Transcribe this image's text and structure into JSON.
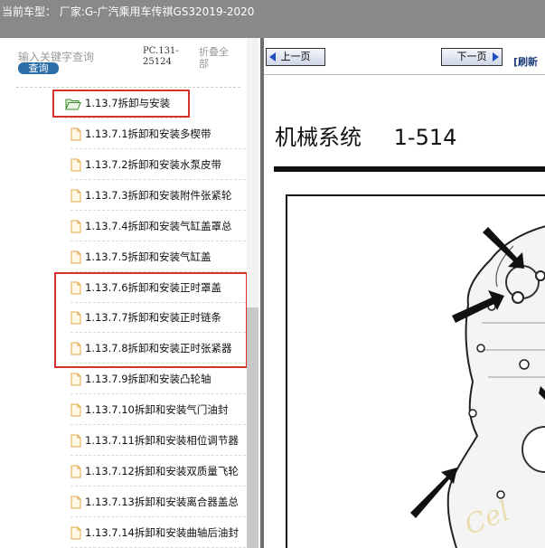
{
  "header": {
    "title": "当前车型：  厂家:G-广汽乘用车传祺GS32019-2020"
  },
  "sidebar": {
    "search_placeholder": "输入关键字查询",
    "query_button": "查询",
    "pc_code": [
      "PC.131-",
      "25124"
    ],
    "fold_all": [
      "折叠全",
      "部"
    ],
    "folder": {
      "label": "1.13.7拆卸与安装",
      "icon": "folder-open-icon"
    },
    "items": [
      {
        "label": "1.13.7.1拆卸和安装多楔带"
      },
      {
        "label": "1.13.7.2拆卸和安装水泵皮带"
      },
      {
        "label": "1.13.7.3拆卸和安装附件张紧轮"
      },
      {
        "label": "1.13.7.4拆卸和安装气缸盖罩总"
      },
      {
        "label": "1.13.7.5拆卸和安装气缸盖"
      },
      {
        "label": "1.13.7.6拆卸和安装正时罩盖"
      },
      {
        "label": "1.13.7.7拆卸和安装正时链条"
      },
      {
        "label": "1.13.7.8拆卸和安装正时张紧器"
      },
      {
        "label": "1.13.7.9拆卸和安装凸轮轴"
      },
      {
        "label": "1.13.7.10拆卸和安装气门油封"
      },
      {
        "label": "1.13.7.11拆卸和安装相位调节器"
      },
      {
        "label": "1.13.7.12拆卸和安装双质量飞轮"
      },
      {
        "label": "1.13.7.13拆卸和安装离合器盖总"
      },
      {
        "label": "1.13.7.14拆卸和安装曲轴后油封"
      }
    ]
  },
  "toolbar": {
    "prev": "上一页",
    "next": "下一页",
    "refresh": "[刷新"
  },
  "page": {
    "title": "机械系统",
    "number": "1-514",
    "watermark": "Cel"
  },
  "colors": {
    "highlight": "#d9312d",
    "title_bar": "#898989",
    "button_blue": "#2b6ea8"
  }
}
